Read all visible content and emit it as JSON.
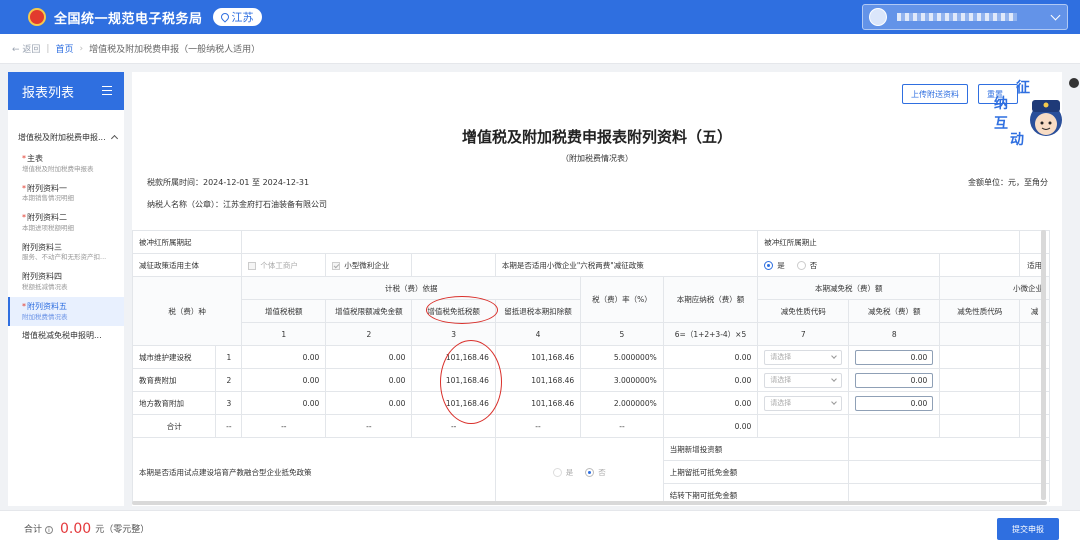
{
  "header": {
    "site_title": "全国统一规范电子税务局",
    "province": "江苏"
  },
  "breadcrumb": {
    "back": "返回",
    "home": "首页",
    "current": "增值税及附加税费申报（一般纳税人适用）"
  },
  "sidebar": {
    "title": "报表列表",
    "group": "增值税及附加税费申报...",
    "items": [
      {
        "label": "主表",
        "sub": "增值税及附加税费申报表",
        "required": true
      },
      {
        "label": "附列资料一",
        "sub": "本期销售情况明细",
        "required": true
      },
      {
        "label": "附列资料二",
        "sub": "本期进项税额明细",
        "required": true
      },
      {
        "label": "附列资料三",
        "sub": "服务、不动产和无形资产扣...",
        "required": false
      },
      {
        "label": "附列资料四",
        "sub": "税额抵减情况表",
        "required": false
      },
      {
        "label": "附列资料五",
        "sub": "附加税费情况表",
        "required": true
      },
      {
        "label": "增值税减免税申报明...",
        "sub": "",
        "required": false
      }
    ]
  },
  "toolbar": {
    "upload": "上传附送资料",
    "reset": "重置"
  },
  "mascot": {
    "text": [
      "征",
      "纳",
      "互",
      "动"
    ]
  },
  "report": {
    "title": "增值税及附加税费申报表附列资料（五）",
    "subtitle": "（附加税费情况表）",
    "period": "税款所属时间：2024-12-01 至 2024-12-31",
    "unit": "金额单位：元，至角分",
    "payer": "纳税人名称（公章）：江苏金府打石油装备有限公司"
  },
  "table": {
    "row_offset_start": "被冲红所属期起",
    "row_offset_end": "被冲红所属期止",
    "row_policy_subject": "减征政策适用主体",
    "individual": "个体工商户",
    "small_micro": "小型微利企业",
    "six_tax_question": "本期是否适用小微企业\"六税两费\"减征政策",
    "yes": "是",
    "no": "否",
    "applicable_partial": "适用",
    "tax_type": "税（费）种",
    "basis": "计税（费）依据",
    "vat_amount": "增值税税额",
    "vat_credit_reduction": "增值税限额减免金额",
    "vat_exempt": "增值税免抵税额",
    "retained_refund": "留抵退税本期扣除额",
    "rate": "税（费）率（%）",
    "payable": "本期应纳税（费）额",
    "reduction": "本期减免税（费）额",
    "reduction_code": "减免性质代码",
    "reduction_amount": "减免税（费）额",
    "small_micro_partial": "小微企业",
    "reduction_code_2": "减免性质代码",
    "reduction_partial": "减",
    "col_nums": [
      "1",
      "2",
      "3",
      "4",
      "5",
      "6=（1+2+3-4）×5",
      "7",
      "8"
    ],
    "rows": [
      {
        "name": "城市维护建设税",
        "no": "1",
        "vat": "0.00",
        "credit": "0.00",
        "exempt": "101,168.46",
        "refund": "101,168.46",
        "rate": "5.000000%",
        "payable": "0.00",
        "select": "请选择",
        "reduce": "0.00"
      },
      {
        "name": "教育费附加",
        "no": "2",
        "vat": "0.00",
        "credit": "0.00",
        "exempt": "101,168.46",
        "refund": "101,168.46",
        "rate": "3.000000%",
        "payable": "0.00",
        "select": "请选择",
        "reduce": "0.00"
      },
      {
        "name": "地方教育附加",
        "no": "3",
        "vat": "0.00",
        "credit": "0.00",
        "exempt": "101,168.46",
        "refund": "101,168.46",
        "rate": "2.000000%",
        "payable": "0.00",
        "select": "请选择",
        "reduce": "0.00"
      }
    ],
    "total_label": "合计",
    "dash": "--",
    "pilot_question": "本期是否适用试点建设培育产教融合型企业抵免政策",
    "pilot_yes": "是",
    "pilot_no": "否",
    "new_investment": "当期新增投资额",
    "prev_remaining": "上期留抵可抵免金额",
    "carry_forward": "结转下期可抵免金额"
  },
  "footer": {
    "total_label": "合计",
    "total_amount": "0.00",
    "total_unit": "元（零元整）",
    "submit": "提交申报"
  },
  "colors": {
    "primary": "#2f6fe0",
    "annotation": "#d9302b",
    "total": "#e4393c"
  }
}
